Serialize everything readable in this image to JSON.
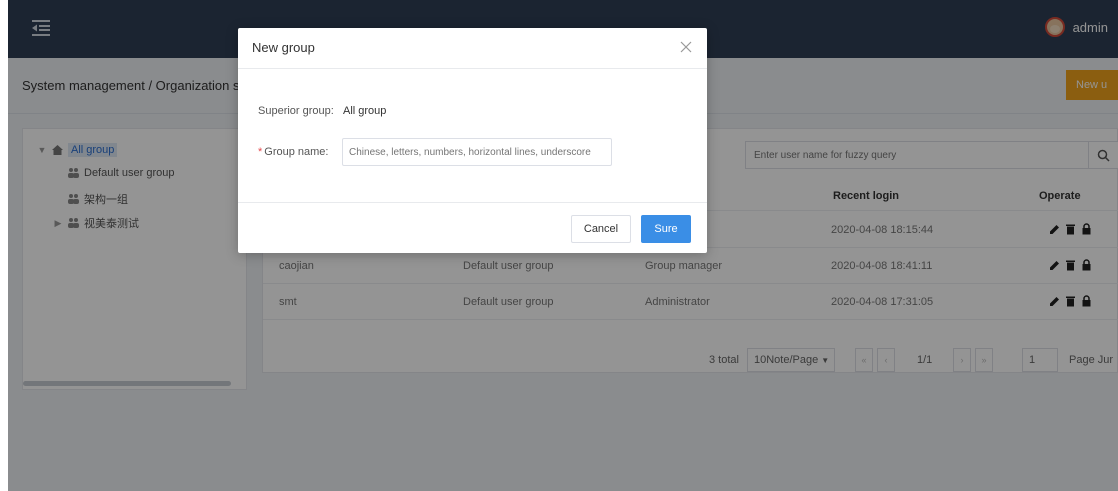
{
  "header": {
    "username": "admin"
  },
  "breadcrumb": "System management  /  Organization s",
  "toolbar": {
    "new_user_label": "New u"
  },
  "tree": {
    "items": [
      {
        "label": "All group"
      },
      {
        "label": "Default user group"
      },
      {
        "label": "架构一组"
      },
      {
        "label": "视美泰测试"
      }
    ]
  },
  "search": {
    "placeholder": "Enter user name for fuzzy query"
  },
  "table": {
    "columns": {
      "recent_login": "Recent login",
      "operate": "Operate"
    },
    "rows": [
      {
        "name": "",
        "group": "",
        "role": "",
        "login": "2020-04-08 18:15:44"
      },
      {
        "name": "caojian",
        "group": "Default user group",
        "role": "Group manager",
        "login": "2020-04-08 18:41:11"
      },
      {
        "name": "smt",
        "group": "Default user group",
        "role": "Administrator",
        "login": "2020-04-08 17:31:05"
      }
    ]
  },
  "pagination": {
    "total": "3 total",
    "page_size": "10Note/Page",
    "pages": "1/1",
    "jump_value": "1",
    "jump_label": "Page Jur"
  },
  "modal": {
    "title": "New group",
    "superior_label": "Superior group:",
    "superior_value": "All group",
    "name_label": "Group name:",
    "name_placeholder": "Chinese, letters, numbers, horizontal lines, underscore",
    "cancel_label": "Cancel",
    "sure_label": "Sure"
  },
  "colors": {
    "accent": "#3a8ee6",
    "warning": "#f0a31c",
    "required": "#e5484d",
    "header_bg": "#2f3f55"
  }
}
